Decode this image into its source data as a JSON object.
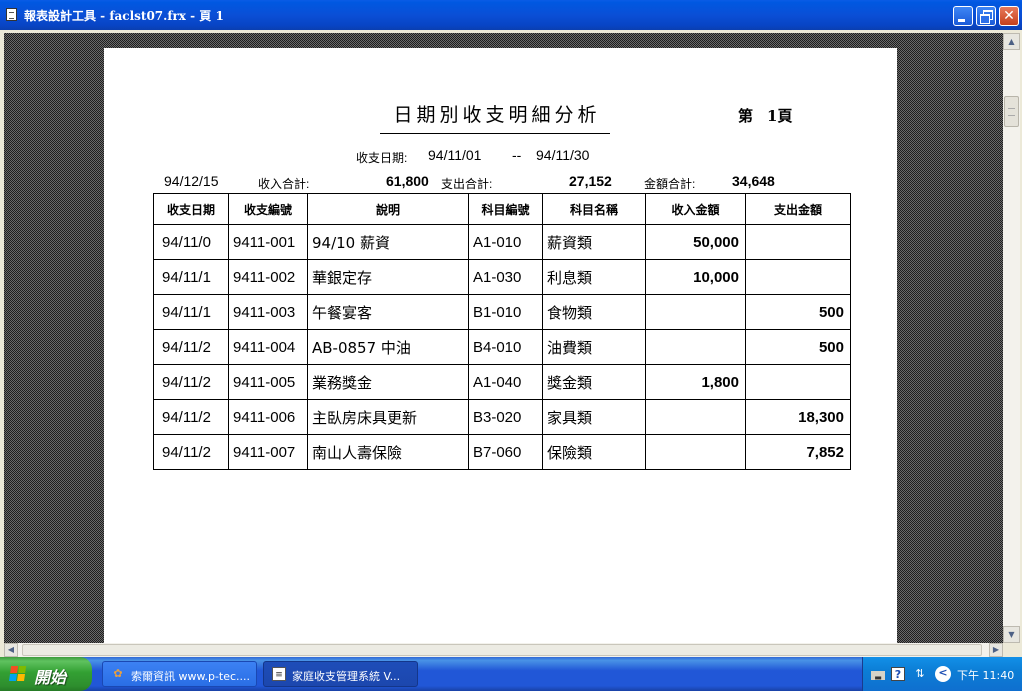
{
  "window": {
    "title": "報表設計工具 - faclst07.frx - 頁 1",
    "minimize_glyph": "",
    "close_glyph": "✕"
  },
  "report": {
    "title": "日期別收支明細分析",
    "page_label": "第",
    "page_number": "1頁",
    "date_range_label": "收支日期:",
    "date_from": "94/11/01",
    "date_sep": "--",
    "date_to": "94/11/30",
    "print_date": "94/12/15",
    "income_total_label": "收入合計:",
    "income_total": "61,800",
    "expense_total_label": "支出合計:",
    "expense_total": "27,152",
    "amount_total_label": "金額合計:",
    "amount_total": "34,648",
    "columns": [
      "收支日期",
      "收支編號",
      "說明",
      "科目編號",
      "科目名稱",
      "收入金額",
      "支出金額"
    ],
    "rows": [
      [
        "94/11/0",
        "9411-001",
        "94/10 薪資",
        "A1-010",
        "薪資類",
        "50,000",
        ""
      ],
      [
        "94/11/1",
        "9411-002",
        "華銀定存",
        "A1-030",
        "利息類",
        "10,000",
        ""
      ],
      [
        "94/11/1",
        "9411-003",
        "午餐宴客",
        "B1-010",
        "食物類",
        "",
        "500"
      ],
      [
        "94/11/2",
        "9411-004",
        "AB-0857 中油",
        "B4-010",
        "油費類",
        "",
        "500"
      ],
      [
        "94/11/2",
        "9411-005",
        "業務獎金",
        "A1-040",
        "獎金類",
        "1,800",
        ""
      ],
      [
        "94/11/2",
        "9411-006",
        "主臥房床具更新",
        "B3-020",
        "家具類",
        "",
        "18,300"
      ],
      [
        "94/11/2",
        "9411-007",
        "南山人壽保險",
        "B7-060",
        "保險類",
        "",
        "7,852"
      ]
    ]
  },
  "scrollbars": {
    "up_glyph": "▲",
    "down_glyph": "▼",
    "left_glyph": "◀",
    "right_glyph": "▶"
  },
  "taskbar": {
    "start_label": "開始",
    "tasks": [
      {
        "icon": "handshake-icon",
        "label": "索爾資訊 www.p-tec...."
      },
      {
        "icon": "report-icon",
        "label": "家庭收支管理系統 V..."
      }
    ],
    "tray": {
      "keyboard": "▬",
      "help": "?",
      "arrows": "⇅",
      "chevron": "<"
    },
    "clock": "下午 11:40"
  },
  "colors": {
    "titlebar": "#0a4fd6",
    "start_green": "#33a033",
    "taskbar_blue": "#2157d7",
    "tray_blue": "#0c7ed6"
  }
}
